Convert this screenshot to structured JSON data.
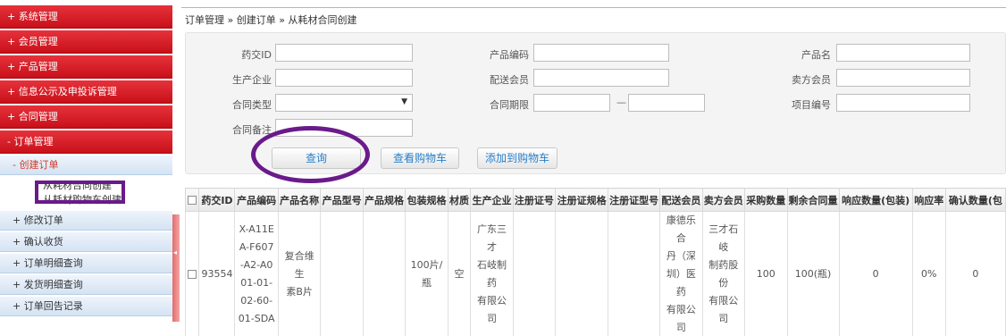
{
  "sidebar": {
    "top_menus": [
      "+ 系统管理",
      "+ 会员管理",
      "+ 产品管理",
      "+ 信息公示及申投诉管理",
      "+ 合同管理",
      "- 订单管理"
    ],
    "create_order": "- 创建订单",
    "leaves": [
      "从耗材合同创建",
      "从耗材购物车创建"
    ],
    "sub_menus": [
      "+ 修改订单",
      "+ 确认收货",
      "+ 订单明细查询",
      "+ 发货明细查询",
      "+ 订单回告记录"
    ],
    "handle_glyph": "◂"
  },
  "breadcrumb": "订单管理 » 创建订单 » 从耗材合同创建",
  "form": {
    "labels": {
      "drug_id": "药交ID",
      "product_code": "产品编码",
      "product_name": "产品名",
      "manufacturer": "生产企业",
      "delivery_member": "配送会员",
      "seller_member": "卖方会员",
      "contract_type": "合同类型",
      "contract_period": "合同期限",
      "project_no": "项目编号",
      "contract_note": "合同备注"
    },
    "period_separator": "—",
    "select_arrow": "▼"
  },
  "buttons": {
    "query": "查询",
    "view_cart": "查看购物车",
    "add_cart": "添加到购物车"
  },
  "table": {
    "headers": [
      "",
      "药交ID",
      "产品编码",
      "产品名称",
      "产品型号",
      "产品规格",
      "包装规格",
      "材质",
      "生产企业",
      "注册证号",
      "注册证规格",
      "注册证型号",
      "配送会员",
      "卖方会员",
      "采购数量",
      "剩余合同量",
      "响应数量(包装)",
      "响应率",
      "确认数量(包"
    ],
    "rows": [
      {
        "drug_id": "93554",
        "product_code": [
          "X-A11E",
          "A-F607",
          "-A2-A0",
          "01-01-",
          "02-60-",
          "01-SDA"
        ],
        "product_name": [
          "复合维生",
          "素B片"
        ],
        "product_model": "",
        "product_spec": "",
        "package_spec": [
          "100片/",
          "瓶"
        ],
        "material": "空",
        "manufacturer": [
          "广东三才",
          "石岐制药",
          "有限公司"
        ],
        "reg_no": "",
        "reg_spec": "",
        "reg_model": "",
        "delivery_member": [
          "康德乐合",
          "丹（深",
          "圳）医药",
          "有限公司"
        ],
        "seller_member": [
          "三才石岐",
          "制药股份",
          "有限公司"
        ],
        "purchase_qty": "100",
        "remaining_qty": "100(瓶)",
        "response_qty": "0",
        "response_rate": "0%",
        "confirm_qty": "0"
      }
    ]
  }
}
